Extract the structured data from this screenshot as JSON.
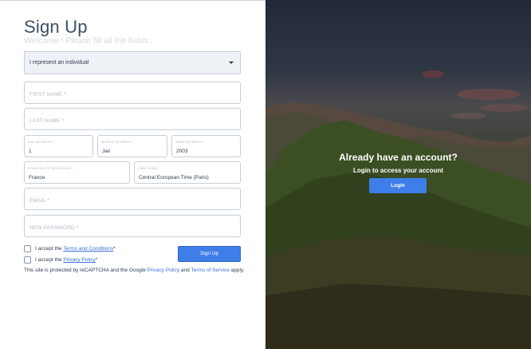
{
  "form": {
    "title": "Sign Up",
    "subtitle": "Welcome ! Please fill all the fields :",
    "account_type": "I represent an individual",
    "first_name_placeholder": "FIRST NAME *",
    "last_name_placeholder": "LAST NAME *",
    "day_label": "DAY OF BIRTH *",
    "day_value": "1",
    "month_label": "MONTH OF BIRTH *",
    "month_value": "Jan",
    "year_label": "YEAR OF BIRTH *",
    "year_value": "2003",
    "country_label": "COUNTRY OF RESIDENCE *",
    "country_value": "France",
    "timezone_label": "TIME ZONE *",
    "timezone_value": "Central European Time (Paris)",
    "email_placeholder": "EMAIL *",
    "password_placeholder": "NEW PASSWORD *",
    "terms_prefix": "I accept the ",
    "terms_link": "Terms and Conditions",
    "terms_suffix": "*",
    "privacy_prefix": "I accept the ",
    "privacy_link": "Privacy Policy",
    "privacy_suffix": "*",
    "submit_label": "Sign Up",
    "recaptcha_prefix": "This site is protected by reCAPTCHA and the Google ",
    "recaptcha_privacy": "Privacy Policy",
    "recaptcha_and": " and ",
    "recaptcha_terms": "Terms of Service",
    "recaptcha_suffix": " apply."
  },
  "login_panel": {
    "title": "Already have an account?",
    "subtitle": "Login to access your account",
    "button_label": "Login"
  },
  "colors": {
    "accent": "#3f7ee8",
    "link": "#3b6fd8",
    "heading": "#3d4f66"
  },
  "icons": {
    "dropdown": "chevron-down-icon"
  }
}
